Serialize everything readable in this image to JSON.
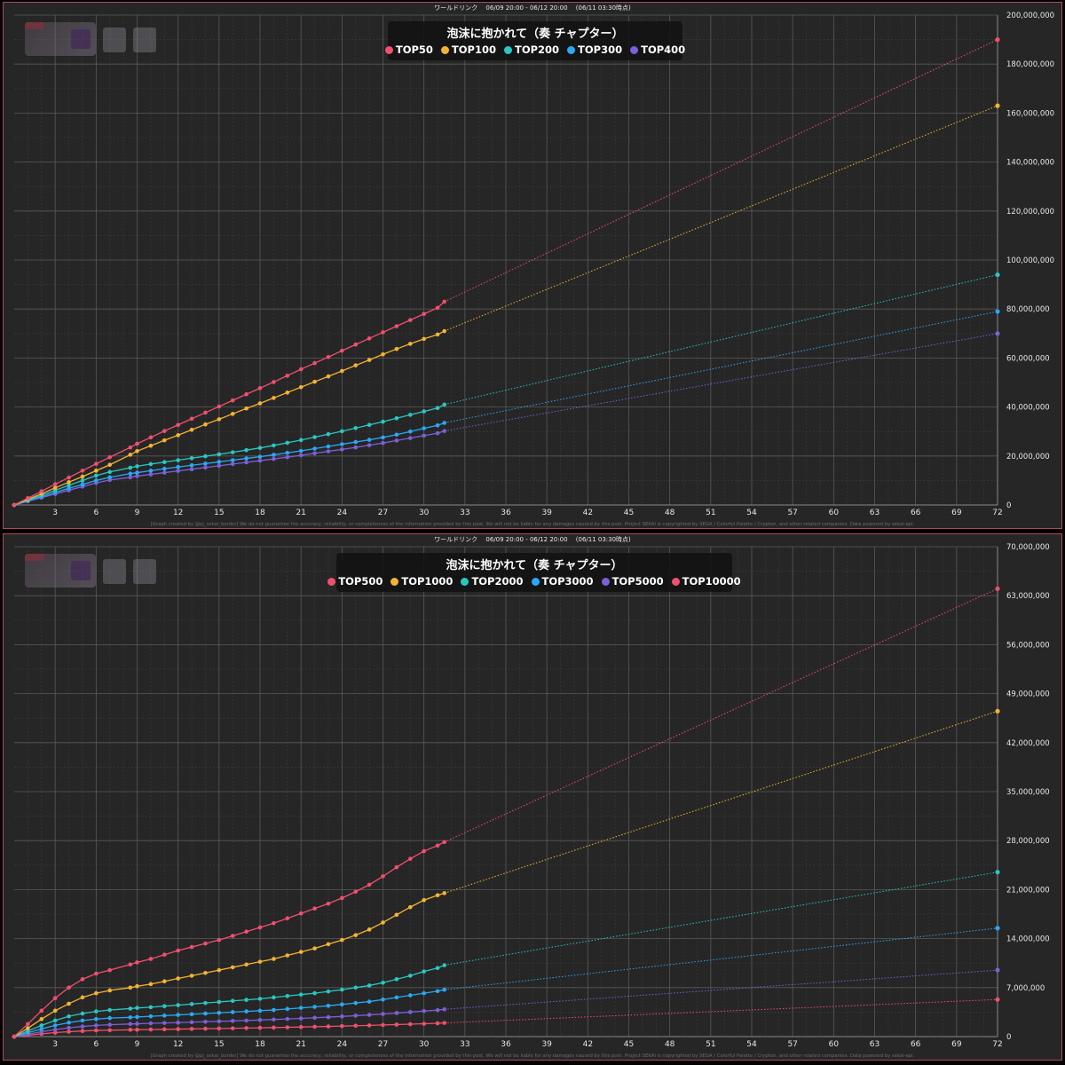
{
  "chart_data": [
    {
      "type": "line",
      "header": "ワールドリンク　 06/09 20:00 - 06/12 20:00　 (06/11 03:30時点)",
      "title": "泡沫に抱かれて（奏 チャプター）",
      "footer": "[Graph created by @pj_sekai_border]  We do not guarantee the accuracy, reliability, or completeness of the information provided by this post. We will not be liable for any damages caused by this post. Project SEKAI is copyrighted by SEGA / Colorful Palette / Crypton, and other related companies. Data powered by sekai-api.",
      "xlim": [
        0,
        72
      ],
      "ylim": [
        0,
        200000000
      ],
      "xticks": [
        3,
        6,
        9,
        12,
        15,
        18,
        21,
        24,
        27,
        30,
        33,
        36,
        39,
        42,
        45,
        48,
        51,
        54,
        57,
        60,
        63,
        66,
        69,
        72
      ],
      "yticks": [
        "0",
        "20,000,000",
        "40,000,000",
        "60,000,000",
        "80,000,000",
        "100,000,000",
        "120,000,000",
        "140,000,000",
        "160,000,000",
        "180,000,000",
        "200,000,000"
      ],
      "ytick_values": [
        0,
        20000000,
        40000000,
        60000000,
        80000000,
        100000000,
        120000000,
        140000000,
        160000000,
        180000000,
        200000000
      ],
      "grid": true,
      "legend_position": "top-center",
      "observed_until": 31.5,
      "series": [
        {
          "name": "TOP50",
          "color": "#f0506e",
          "x": [
            0,
            1,
            2,
            3,
            4,
            5,
            6,
            7,
            8.5,
            9,
            10,
            11,
            12,
            13,
            14,
            15,
            16,
            17,
            18,
            19,
            20,
            21,
            22,
            23,
            24,
            25,
            26,
            27,
            28,
            29,
            30,
            31,
            31.5
          ],
          "values": [
            0,
            2800000,
            5600000,
            8500000,
            11200000,
            14000000,
            16800000,
            19500000,
            23500000,
            25000000,
            27600000,
            30200000,
            32700000,
            35200000,
            37700000,
            40200000,
            42700000,
            45200000,
            47700000,
            50200000,
            52800000,
            55400000,
            57900000,
            60400000,
            63000000,
            65500000,
            68000000,
            70500000,
            73000000,
            75500000,
            78000000,
            80500000,
            83000000
          ],
          "end_x": 72,
          "end_value": 190000000
        },
        {
          "name": "TOP100",
          "color": "#f5b335",
          "x": [
            0,
            1,
            2,
            3,
            4,
            5,
            6,
            7,
            8.5,
            9,
            10,
            11,
            12,
            13,
            14,
            15,
            16,
            17,
            18,
            19,
            20,
            21,
            22,
            23,
            24,
            25,
            26,
            27,
            28,
            29,
            30,
            31,
            31.5
          ],
          "values": [
            0,
            2300000,
            4600000,
            7000000,
            9300000,
            11600000,
            14000000,
            16400000,
            20500000,
            22000000,
            24200000,
            26400000,
            28500000,
            30700000,
            32900000,
            35000000,
            37200000,
            39400000,
            41500000,
            43700000,
            45900000,
            48100000,
            50300000,
            52500000,
            54700000,
            57000000,
            59200000,
            61500000,
            63700000,
            65800000,
            67800000,
            69600000,
            71000000
          ],
          "end_x": 72,
          "end_value": 163000000
        },
        {
          "name": "TOP200",
          "color": "#2ac7c1",
          "x": [
            0,
            1,
            2,
            3,
            4,
            5,
            6,
            7,
            8.5,
            9,
            10,
            11,
            12,
            13,
            14,
            15,
            16,
            17,
            18,
            19,
            20,
            21,
            22,
            23,
            24,
            25,
            26,
            27,
            28,
            29,
            30,
            31,
            31.5
          ],
          "values": [
            0,
            2000000,
            4000000,
            6000000,
            8000000,
            10000000,
            12000000,
            13500000,
            15200000,
            15800000,
            16700000,
            17500000,
            18300000,
            19100000,
            19900000,
            20700000,
            21500000,
            22400000,
            23300000,
            24300000,
            25400000,
            26500000,
            27700000,
            28900000,
            30100000,
            31400000,
            32700000,
            34000000,
            35400000,
            36800000,
            38200000,
            39600000,
            41000000
          ],
          "end_x": 72,
          "end_value": 94000000
        },
        {
          "name": "TOP300",
          "color": "#2aa8f5",
          "x": [
            0,
            1,
            2,
            3,
            4,
            5,
            6,
            7,
            8.5,
            9,
            10,
            11,
            12,
            13,
            14,
            15,
            16,
            17,
            18,
            19,
            20,
            21,
            22,
            23,
            24,
            25,
            26,
            27,
            28,
            29,
            30,
            31,
            31.5
          ],
          "values": [
            0,
            1700000,
            3400000,
            5100000,
            6800000,
            8400000,
            10000000,
            11300000,
            12800000,
            13200000,
            14000000,
            14800000,
            15500000,
            16200000,
            16900000,
            17600000,
            18300000,
            19000000,
            19700000,
            20500000,
            21300000,
            22100000,
            23000000,
            23900000,
            24800000,
            25700000,
            26600000,
            27600000,
            28700000,
            30000000,
            31300000,
            32500000,
            33500000
          ],
          "end_x": 72,
          "end_value": 79000000
        },
        {
          "name": "TOP400",
          "color": "#7d5fd8",
          "x": [
            0,
            1,
            2,
            3,
            4,
            5,
            6,
            7,
            8.5,
            9,
            10,
            11,
            12,
            13,
            14,
            15,
            16,
            17,
            18,
            19,
            20,
            21,
            22,
            23,
            24,
            25,
            26,
            27,
            28,
            29,
            30,
            31,
            31.5
          ],
          "values": [
            0,
            1500000,
            3000000,
            4500000,
            6000000,
            7500000,
            9000000,
            10200000,
            11300000,
            11800000,
            12500000,
            13200000,
            13900000,
            14600000,
            15300000,
            16000000,
            16700000,
            17400000,
            18100000,
            18800000,
            19500000,
            20300000,
            21100000,
            21900000,
            22700000,
            23500000,
            24400000,
            25300000,
            26300000,
            27300000,
            28300000,
            29300000,
            30200000
          ],
          "end_x": 72,
          "end_value": 70000000
        }
      ]
    },
    {
      "type": "line",
      "header": "ワールドリンク　 06/09 20:00 - 06/12 20:00　 (06/11 03:30時点)",
      "title": "泡沫に抱かれて（奏 チャプター）",
      "footer": "[Graph created by @pj_sekai_border]  We do not guarantee the accuracy, reliability, or completeness of the information provided by this post. We will not be liable for any damages caused by this post. Project SEKAI is copyrighted by SEGA / Colorful Palette / Crypton, and other related companies. Data powered by sekai-api.",
      "xlim": [
        0,
        72
      ],
      "ylim": [
        0,
        70000000
      ],
      "xticks": [
        3,
        6,
        9,
        12,
        15,
        18,
        21,
        24,
        27,
        30,
        33,
        36,
        39,
        42,
        45,
        48,
        51,
        54,
        57,
        60,
        63,
        66,
        69,
        72
      ],
      "yticks": [
        "0",
        "7,000,000",
        "14,000,000",
        "21,000,000",
        "28,000,000",
        "35,000,000",
        "42,000,000",
        "49,000,000",
        "56,000,000",
        "63,000,000",
        "70,000,000"
      ],
      "ytick_values": [
        0,
        7000000,
        14000000,
        21000000,
        28000000,
        35000000,
        42000000,
        49000000,
        56000000,
        63000000,
        70000000
      ],
      "grid": true,
      "legend_position": "top-center",
      "observed_until": 31.5,
      "series": [
        {
          "name": "TOP500",
          "color": "#f0506e",
          "x": [
            0,
            1,
            2,
            3,
            4,
            5,
            6,
            7,
            8.5,
            9,
            10,
            11,
            12,
            13,
            14,
            15,
            16,
            17,
            18,
            19,
            20,
            21,
            22,
            23,
            24,
            25,
            26,
            27,
            28,
            29,
            30,
            31,
            31.5
          ],
          "values": [
            0,
            1800000,
            3700000,
            5500000,
            7000000,
            8200000,
            9000000,
            9500000,
            10300000,
            10600000,
            11100000,
            11700000,
            12300000,
            12800000,
            13300000,
            13800000,
            14400000,
            15000000,
            15600000,
            16200000,
            16900000,
            17600000,
            18300000,
            19000000,
            19800000,
            20700000,
            21700000,
            22900000,
            24200000,
            25400000,
            26500000,
            27300000,
            27800000
          ],
          "end_x": 72,
          "end_value": 64000000
        },
        {
          "name": "TOP1000",
          "color": "#f5b335",
          "x": [
            0,
            1,
            2,
            3,
            4,
            5,
            6,
            7,
            8.5,
            9,
            10,
            11,
            12,
            13,
            14,
            15,
            16,
            17,
            18,
            19,
            20,
            21,
            22,
            23,
            24,
            25,
            26,
            27,
            28,
            29,
            30,
            31,
            31.5
          ],
          "values": [
            0,
            1200000,
            2500000,
            3700000,
            4700000,
            5600000,
            6200000,
            6600000,
            7000000,
            7200000,
            7500000,
            7900000,
            8300000,
            8700000,
            9100000,
            9500000,
            9900000,
            10300000,
            10700000,
            11100000,
            11600000,
            12100000,
            12600000,
            13200000,
            13800000,
            14500000,
            15300000,
            16300000,
            17400000,
            18500000,
            19500000,
            20200000,
            20500000
          ],
          "end_x": 72,
          "end_value": 46500000
        },
        {
          "name": "TOP2000",
          "color": "#2ac7c1",
          "x": [
            0,
            1,
            2,
            3,
            4,
            5,
            6,
            7,
            8.5,
            9,
            10,
            11,
            12,
            13,
            14,
            15,
            16,
            17,
            18,
            19,
            20,
            21,
            22,
            23,
            24,
            25,
            26,
            27,
            28,
            29,
            30,
            31,
            31.5
          ],
          "values": [
            0,
            800000,
            1600000,
            2300000,
            2900000,
            3300000,
            3600000,
            3800000,
            4000000,
            4100000,
            4200000,
            4350000,
            4500000,
            4650000,
            4800000,
            4950000,
            5100000,
            5250000,
            5400000,
            5600000,
            5800000,
            6000000,
            6200000,
            6450000,
            6700000,
            7000000,
            7300000,
            7700000,
            8200000,
            8700000,
            9300000,
            9800000,
            10200000
          ],
          "end_x": 72,
          "end_value": 23500000
        },
        {
          "name": "TOP3000",
          "color": "#2aa8f5",
          "x": [
            0,
            1,
            2,
            3,
            4,
            5,
            6,
            7,
            8.5,
            9,
            10,
            11,
            12,
            13,
            14,
            15,
            16,
            17,
            18,
            19,
            20,
            21,
            22,
            23,
            24,
            25,
            26,
            27,
            28,
            29,
            30,
            31,
            31.5
          ],
          "values": [
            0,
            550000,
            1100000,
            1600000,
            2000000,
            2300000,
            2500000,
            2650000,
            2750000,
            2800000,
            2900000,
            3000000,
            3100000,
            3200000,
            3300000,
            3400000,
            3500000,
            3600000,
            3700000,
            3800000,
            3950000,
            4100000,
            4250000,
            4400000,
            4600000,
            4800000,
            5000000,
            5300000,
            5600000,
            5900000,
            6200000,
            6500000,
            6700000
          ],
          "end_x": 72,
          "end_value": 15500000
        },
        {
          "name": "TOP5000",
          "color": "#7d5fd8",
          "x": [
            0,
            1,
            2,
            3,
            4,
            5,
            6,
            7,
            8.5,
            9,
            10,
            11,
            12,
            13,
            14,
            15,
            16,
            17,
            18,
            19,
            20,
            21,
            22,
            23,
            24,
            25,
            26,
            27,
            28,
            29,
            30,
            31,
            31.5
          ],
          "values": [
            0,
            350000,
            700000,
            1000000,
            1250000,
            1450000,
            1600000,
            1700000,
            1800000,
            1830000,
            1900000,
            1950000,
            2000000,
            2060000,
            2120000,
            2180000,
            2240000,
            2300000,
            2370000,
            2440000,
            2520000,
            2600000,
            2690000,
            2780000,
            2880000,
            2990000,
            3100000,
            3230000,
            3370000,
            3510000,
            3650000,
            3780000,
            3900000
          ],
          "end_x": 72,
          "end_value": 9500000
        },
        {
          "name": "TOP10000",
          "color": "#f0506e",
          "x": [
            0,
            1,
            2,
            3,
            4,
            5,
            6,
            7,
            8.5,
            9,
            10,
            11,
            12,
            13,
            14,
            15,
            16,
            17,
            18,
            19,
            20,
            21,
            22,
            23,
            24,
            25,
            26,
            27,
            28,
            29,
            30,
            31,
            31.5
          ],
          "values": [
            0,
            200000,
            400000,
            570000,
            700000,
            800000,
            880000,
            920000,
            970000,
            990000,
            1010000,
            1040000,
            1070000,
            1100000,
            1130000,
            1160000,
            1190000,
            1220000,
            1250000,
            1290000,
            1330000,
            1370000,
            1410000,
            1450000,
            1500000,
            1550000,
            1600000,
            1660000,
            1720000,
            1780000,
            1840000,
            1900000,
            1950000
          ],
          "end_x": 72,
          "end_value": 5300000
        }
      ]
    }
  ]
}
